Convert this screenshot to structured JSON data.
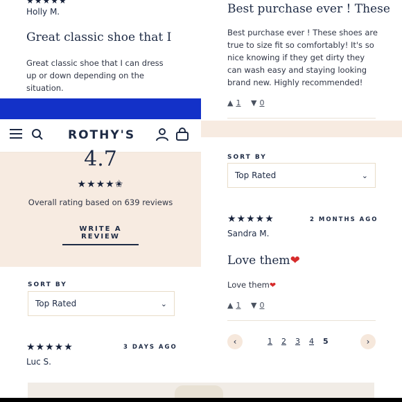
{
  "left_top": {
    "reviewer": "Holly M.",
    "title": "Great classic shoe that I",
    "body": "Great classic shoe that I can dress up or down depending on the situation."
  },
  "header": {
    "brand": "ROTHY'S"
  },
  "rating": {
    "score": "4.7",
    "stars": "★★★★✬",
    "summary": "Overall rating based on 639 reviews",
    "write_review": "WRITE A REVIEW"
  },
  "left_sort": {
    "label": "SORT BY",
    "value": "Top Rated"
  },
  "left_review": {
    "stars": "★★★★★",
    "age": "3 DAYS AGO",
    "reviewer": "Luc S."
  },
  "right_top": {
    "title": "Best purchase ever ! These",
    "body": "Best purchase ever ! These shoes are true to size fit so comfortably! It's so nice knowing if they get dirty they can wash easy and staying looking brand new. Highly recommended!",
    "helpful": "1",
    "unhelpful": "0"
  },
  "right_sort": {
    "label": "SORT BY",
    "value": "Top Rated"
  },
  "right_review": {
    "stars": "★★★★★",
    "age": "2 MONTHS AGO",
    "reviewer": "Sandra M.",
    "title": "Love them",
    "body": "Love them",
    "helpful": "1",
    "unhelpful": "0"
  },
  "pagination": {
    "pages": [
      "1",
      "2",
      "3",
      "4",
      "5"
    ],
    "current": "5",
    "prev": "‹",
    "next": "›"
  },
  "icons": {
    "menu": "☰",
    "search": "⚲",
    "account": "person",
    "bag": "bag",
    "chevron": "⌄",
    "thumbs_up": "👍",
    "thumbs_down": "👎",
    "heart": "❤"
  },
  "colors": {
    "navy": "#1d2a44",
    "blue_banner": "#1331c8",
    "peach": "#f7ebe1",
    "heart": "#d62b2b"
  }
}
